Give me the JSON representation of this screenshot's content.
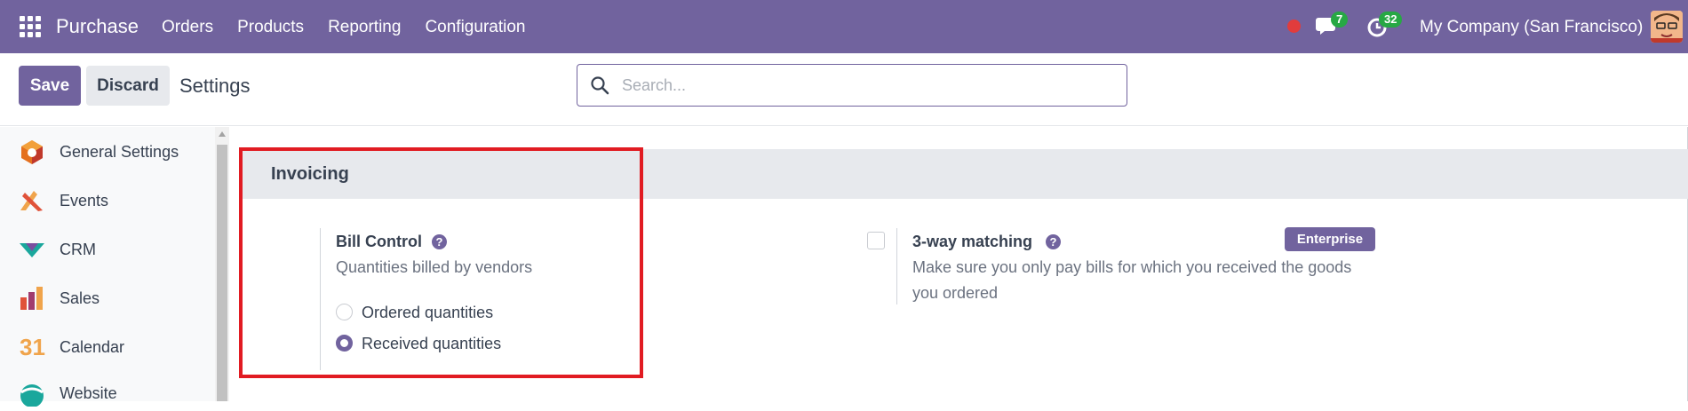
{
  "navbar": {
    "app_name": "Purchase",
    "menu": [
      "Orders",
      "Products",
      "Reporting",
      "Configuration"
    ],
    "chat_count": "7",
    "activity_count": "32",
    "company": "My Company (San Francisco)"
  },
  "control": {
    "save_label": "Save",
    "discard_label": "Discard",
    "title": "Settings",
    "search_placeholder": "Search..."
  },
  "sidebar": {
    "items": [
      {
        "label": "General Settings",
        "icon": "general-settings-icon"
      },
      {
        "label": "Events",
        "icon": "events-icon"
      },
      {
        "label": "CRM",
        "icon": "crm-icon"
      },
      {
        "label": "Sales",
        "icon": "sales-icon"
      },
      {
        "label": "Calendar",
        "icon": "calendar-icon",
        "icon_text": "31"
      },
      {
        "label": "Website",
        "icon": "website-icon"
      }
    ]
  },
  "section": {
    "title": "Invoicing",
    "bill_control": {
      "label": "Bill Control",
      "description": "Quantities billed by vendors",
      "options": [
        "Ordered quantities",
        "Received quantities"
      ],
      "selected": "Received quantities"
    },
    "three_way": {
      "label": "3-way matching",
      "description_line1": "Make sure you only pay bills for which you received the goods",
      "description_line2": "you ordered",
      "checked": false,
      "badge": "Enterprise"
    }
  },
  "colors": {
    "brand": "#71639e",
    "highlight": "#e11b22",
    "badge_green": "#27a844"
  }
}
